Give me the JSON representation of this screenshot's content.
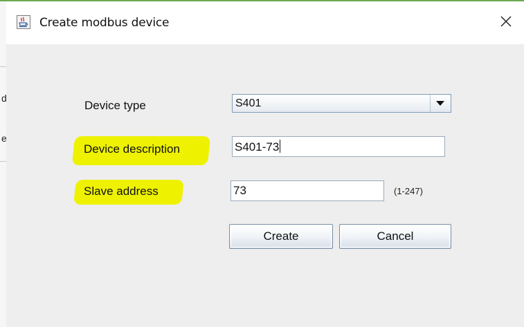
{
  "window": {
    "title": "Create modbus device",
    "close_symbol": "✕",
    "app_icon": "java-cup-icon"
  },
  "background": {
    "fragments": [
      "d",
      "e"
    ]
  },
  "form": {
    "device_type": {
      "label": "Device type",
      "value": "S401",
      "dropdown_icon": "chevron-down-icon"
    },
    "device_description": {
      "label": "Device description",
      "value": "S401-73",
      "highlighted": true
    },
    "slave_address": {
      "label": "Slave address",
      "value": "73",
      "range_hint": "(1-247)",
      "highlighted": true
    }
  },
  "buttons": {
    "create_label": "Create",
    "cancel_label": "Cancel"
  },
  "colors": {
    "highlight": "#eef200",
    "window_background": "#eeeeee",
    "title_accent": "#6aa84f"
  }
}
